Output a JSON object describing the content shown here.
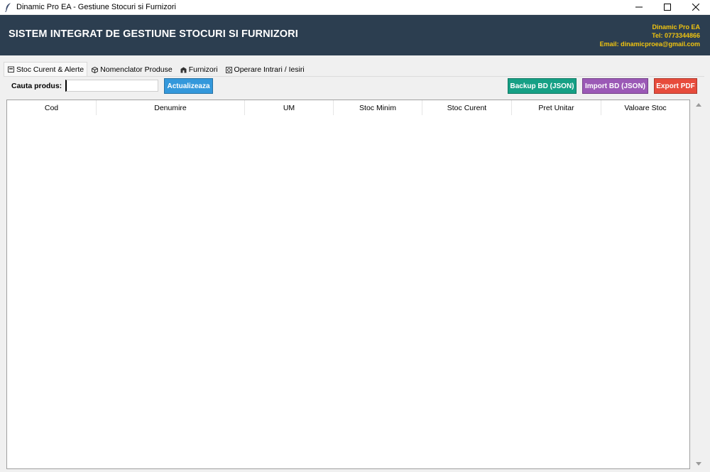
{
  "window": {
    "title": "Dinamic Pro EA - Gestiune Stocuri si Furnizori",
    "app_icon": "feather-icon"
  },
  "header": {
    "system_title": "SISTEM INTEGRAT DE GESTIUNE STOCURI SI FURNIZORI",
    "company_name": "Dinamic Pro EA",
    "phone": "Tel: 0773344866",
    "email": "Email: dinamicproea@gmail.com",
    "background": "#2c3e50",
    "accent": "#f1c40f"
  },
  "tabs": [
    {
      "label": "Stoc Curent & Alerte",
      "icon": "inventory-icon",
      "active": true
    },
    {
      "label": "Nomenclator Produse",
      "icon": "box-icon",
      "active": false
    },
    {
      "label": "Furnizori",
      "icon": "building-icon",
      "active": false
    },
    {
      "label": "Operare Intrari / Iesiri",
      "icon": "operations-icon",
      "active": false
    }
  ],
  "toolbar": {
    "search_label": "Cauta produs:",
    "search_value": "",
    "refresh_label": "Actualizeaza",
    "backup_label": "Backup BD (JSON)",
    "import_label": "Import BD (JSON)",
    "export_label": "Export PDF",
    "colors": {
      "refresh": "#3498db",
      "backup": "#16a085",
      "import": "#9b59b6",
      "export": "#e74c3c"
    }
  },
  "table": {
    "columns": [
      "Cod",
      "Denumire",
      "UM",
      "Stoc Minim",
      "Stoc Curent",
      "Pret Unitar",
      "Valoare Stoc"
    ],
    "rows": []
  }
}
